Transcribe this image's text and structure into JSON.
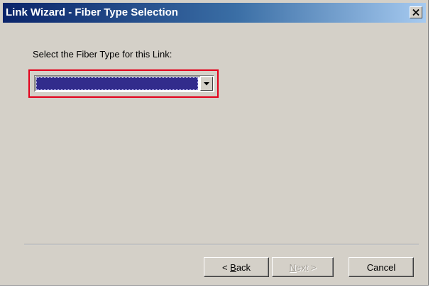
{
  "window": {
    "title": "Link Wizard - Fiber Type Selection",
    "close_icon": "close-icon"
  },
  "content": {
    "prompt": "Select the Fiber Type for this Link:",
    "fiber_type_select": {
      "selected_value": "",
      "highlight_color": "#e3001b",
      "selection_color": "#322c8c"
    }
  },
  "buttons": {
    "back": {
      "prefix": "< ",
      "accel": "B",
      "rest": "ack",
      "enabled": true
    },
    "next": {
      "accel": "N",
      "rest": "ext >",
      "enabled": false
    },
    "cancel": {
      "label": "Cancel",
      "enabled": true
    }
  },
  "colors": {
    "dialog_bg": "#d4d0c8",
    "title_start": "#0a246a",
    "title_end": "#a6caf0"
  }
}
